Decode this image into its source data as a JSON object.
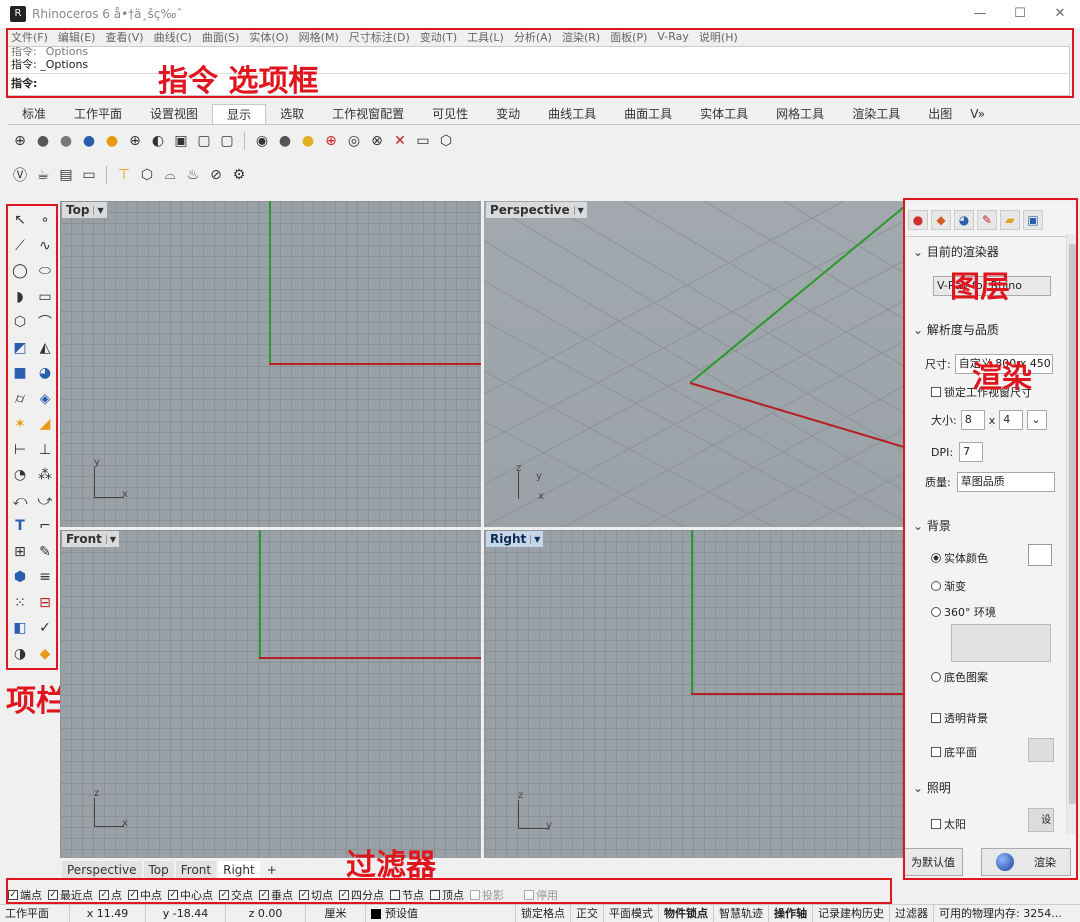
{
  "window": {
    "title": "Rhinoceros 6 å•†ä¸šç‰ˆ",
    "app_icon": "rhino-icon",
    "minimize": "—",
    "maximize": "☐",
    "close": "✕"
  },
  "menu": [
    "文件(F)",
    "编辑(E)",
    "查看(V)",
    "曲线(C)",
    "曲面(S)",
    "实体(O)",
    "网格(M)",
    "尺寸标注(D)",
    "变动(T)",
    "工具(L)",
    "分析(A)",
    "渲染(R)",
    "面板(P)",
    "V-Ray",
    "说明(H)"
  ],
  "command": {
    "history_1": "指令: _Options",
    "history_2": "指令: _Options",
    "prompt": "指令:"
  },
  "tabs": [
    "标准",
    "工作平面",
    "设置视图",
    "显示",
    "选取",
    "工作视窗配置",
    "可见性",
    "变动",
    "曲线工具",
    "曲面工具",
    "实体工具",
    "网格工具",
    "渲染工具",
    "出图",
    "V»"
  ],
  "active_tab": "显示",
  "viewports": {
    "top": "Top",
    "perspective": "Perspective",
    "front": "Front",
    "right": "Right"
  },
  "axis_labels": {
    "x": "x",
    "y": "y",
    "z": "z"
  },
  "viewport_tabs": [
    "Perspective",
    "Top",
    "Front",
    "Right"
  ],
  "viewport_tab_add": "+",
  "panel": {
    "renderer_section": "目前的渲染器",
    "renderer_value": "V-Ray for Rhino",
    "resolution_section": "解析度与品质",
    "size_label": "尺寸:",
    "size_value": "自定义 800 x 450",
    "lock_viewport": "锁定工作视窗尺寸",
    "dim_label": "大小:",
    "dim_w": "8",
    "dim_x": "x",
    "dim_h": "4",
    "dpi_label": "DPI:",
    "dpi_value": "7",
    "quality_label": "质量:",
    "quality_value": "草图品质",
    "background_section": "背景",
    "bg_solid": "实体颜色",
    "bg_gradient": "渐变",
    "bg_360": "360° 环境",
    "bg_wallpaper": "底色图案",
    "transparent_bg": "透明背景",
    "ground_plane": "底平面",
    "lighting_section": "照明",
    "sun": "太阳",
    "sun_settings": "设",
    "set_default": "为默认值",
    "render": "渲染"
  },
  "osnaps": [
    {
      "label": "端点",
      "on": true
    },
    {
      "label": "最近点",
      "on": true
    },
    {
      "label": "点",
      "on": true
    },
    {
      "label": "中点",
      "on": true
    },
    {
      "label": "中心点",
      "on": true
    },
    {
      "label": "交点",
      "on": true
    },
    {
      "label": "垂点",
      "on": true
    },
    {
      "label": "切点",
      "on": true
    },
    {
      "label": "四分点",
      "on": true
    },
    {
      "label": "节点",
      "on": false
    },
    {
      "label": "顶点",
      "on": false
    },
    {
      "label": "投影",
      "on": false
    },
    {
      "label": "停用",
      "on": false
    }
  ],
  "status": {
    "cplane": "工作平面",
    "x": "x 11.49",
    "y": "y -18.44",
    "z": "z 0.00",
    "unit": "厘米",
    "layer": "预设值",
    "grid_snap": "锁定格点",
    "ortho": "正交",
    "planar": "平面模式",
    "osnap": "物件锁点",
    "smarttrack": "智慧轨迹",
    "gumball": "操作轴",
    "history": "记录建构历史",
    "filter": "过滤器",
    "memory": "可用的物理内存: 3254..."
  },
  "annotations": {
    "command_options": "指令 选项框",
    "toolbar": "项栏",
    "layer": "图层",
    "render": "渲染",
    "filter": "过滤器"
  },
  "colors": {
    "annotation": "#e0161e",
    "viewport_bg": "#9aa1a6",
    "x_axis": "#b52020",
    "y_axis": "#2a9a2a"
  }
}
